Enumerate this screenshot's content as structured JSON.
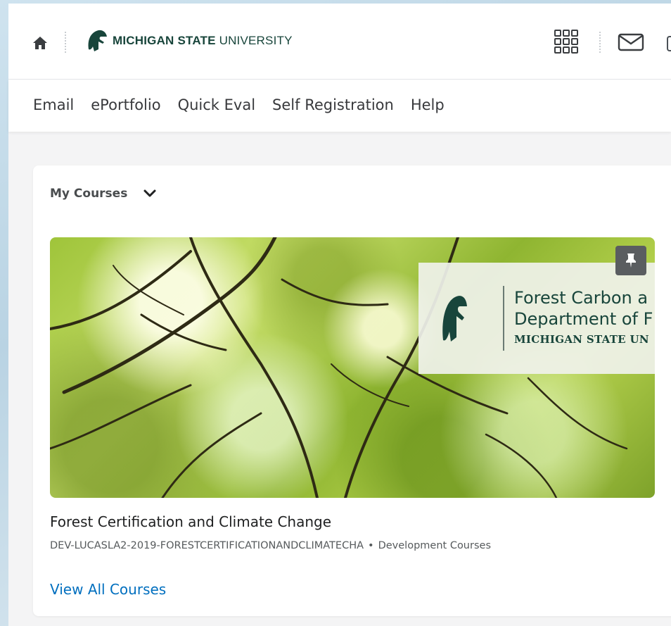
{
  "header": {
    "brand_bold": "MICHIGAN STATE",
    "brand_light": " UNIVERSITY"
  },
  "nav": {
    "items": [
      {
        "label": "Email"
      },
      {
        "label": "ePortfolio"
      },
      {
        "label": "Quick Eval"
      },
      {
        "label": "Self Registration"
      },
      {
        "label": "Help"
      }
    ]
  },
  "widget": {
    "title": "My Courses",
    "course": {
      "banner_line1": "Forest Carbon a",
      "banner_line2": "Department of F",
      "banner_line3": "MICHIGAN STATE UN",
      "name": "Forest Certification and Climate Change",
      "code": "DEV-LUCASLA2-2019-FORESTCERTIFICATIONANDCLIMATECHA",
      "separator": "•",
      "department": "Development Courses"
    },
    "view_all_label": "View All Courses"
  },
  "icons": {
    "home": "home-icon",
    "logo": "spartan-helmet-icon",
    "apps": "grid-icon",
    "mail": "mail-icon",
    "expand": "chevron-down-icon",
    "pin": "pin-icon"
  },
  "colors": {
    "brand_green": "#18453b",
    "link_blue": "#006fbf",
    "nav_text": "#38393c"
  }
}
